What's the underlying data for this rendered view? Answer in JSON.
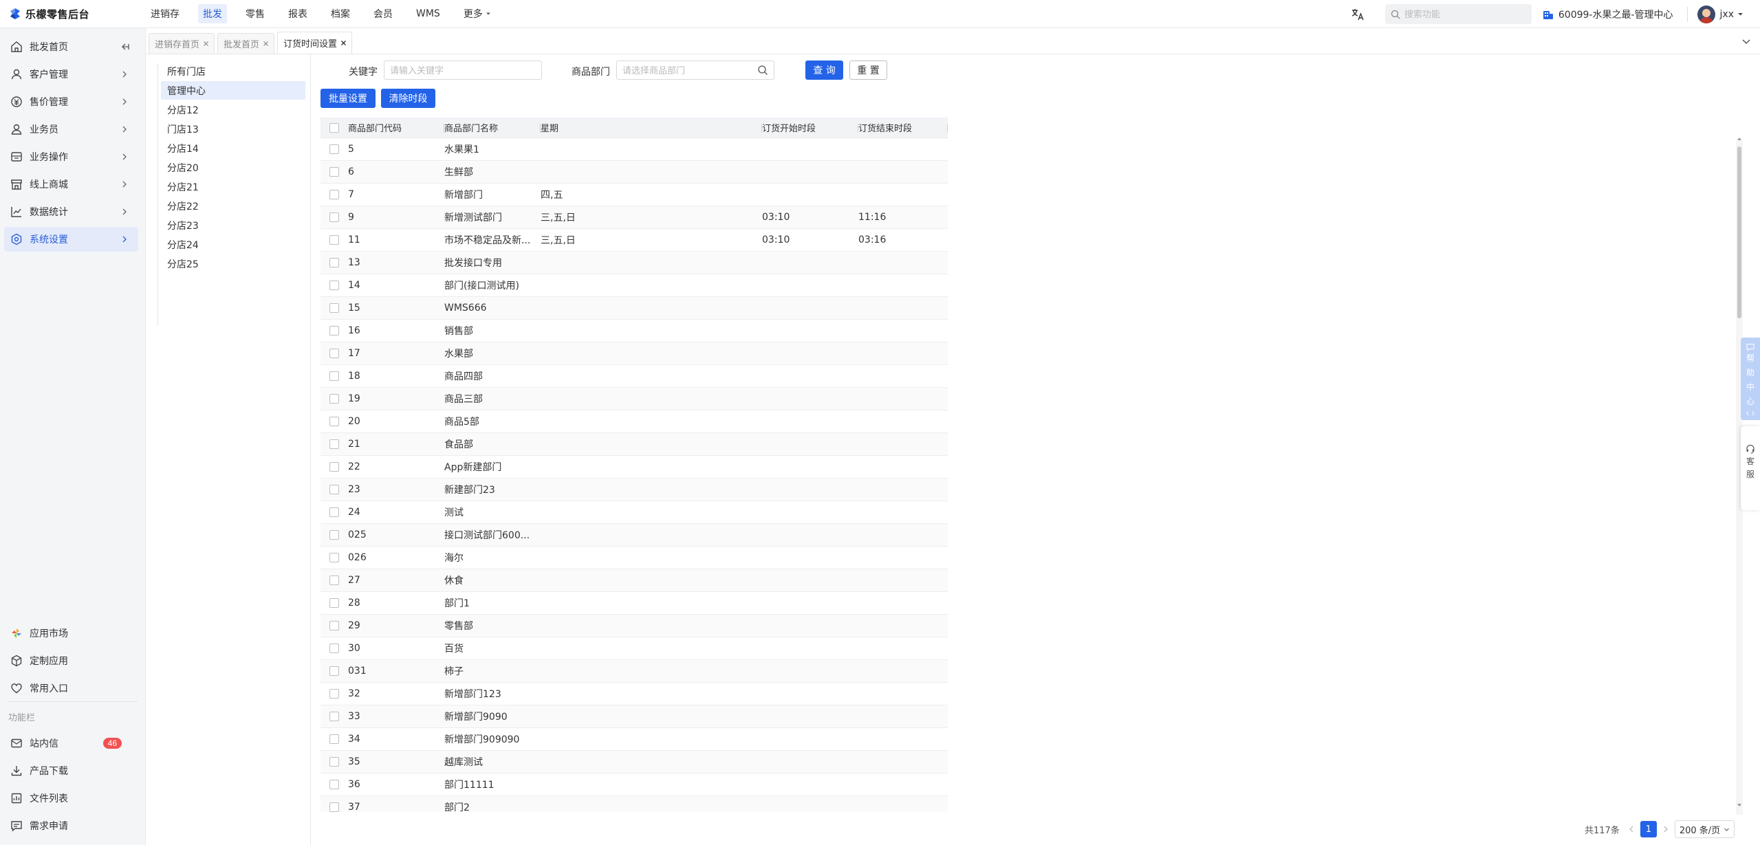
{
  "app": {
    "title": "乐檬零售后台",
    "brand_color": "#2463e8"
  },
  "topnav": {
    "items": [
      {
        "label": "进销存",
        "active": false
      },
      {
        "label": "批发",
        "active": true
      },
      {
        "label": "零售",
        "active": false
      },
      {
        "label": "报表",
        "active": false
      },
      {
        "label": "档案",
        "active": false
      },
      {
        "label": "会员",
        "active": false
      },
      {
        "label": "WMS",
        "active": false
      },
      {
        "label": "更多",
        "active": false
      }
    ],
    "search_placeholder": "搜索功能",
    "org_label": "60099-水果之最-管理中心",
    "user_name": "jxx"
  },
  "sidebar": {
    "items": [
      {
        "label": "批发首页",
        "icon": "home-icon"
      },
      {
        "label": "客户管理",
        "icon": "user-icon"
      },
      {
        "label": "售价管理",
        "icon": "price-icon"
      },
      {
        "label": "业务员",
        "icon": "salesman-icon"
      },
      {
        "label": "业务操作",
        "icon": "operation-icon"
      },
      {
        "label": "线上商城",
        "icon": "store-icon"
      },
      {
        "label": "数据统计",
        "icon": "chart-icon"
      },
      {
        "label": "系统设置",
        "icon": "settings-icon",
        "active": true
      }
    ],
    "bottom_items": [
      {
        "label": "应用市场",
        "icon": "app-market-icon"
      },
      {
        "label": "定制应用",
        "icon": "custom-app-icon"
      },
      {
        "label": "常用入口",
        "icon": "heart-icon"
      }
    ],
    "section_label": "功能栏",
    "tool_items": [
      {
        "label": "站内信",
        "icon": "message-icon",
        "badge": "46"
      },
      {
        "label": "产品下载",
        "icon": "download-icon"
      },
      {
        "label": "文件列表",
        "icon": "file-list-icon"
      },
      {
        "label": "需求申请",
        "icon": "request-icon"
      }
    ]
  },
  "tabs": [
    {
      "label": "进销存首页",
      "active": false
    },
    {
      "label": "批发首页",
      "active": false
    },
    {
      "label": "订货时间设置",
      "active": true
    }
  ],
  "store_tree": {
    "items": [
      "所有门店",
      "管理中心",
      "分店12",
      "门店13",
      "分店14",
      "分店20",
      "分店21",
      "分店22",
      "分店23",
      "分店24",
      "分店25"
    ],
    "selected": "管理中心"
  },
  "filters": {
    "keyword_label": "关键字",
    "keyword_placeholder": "请输入关键字",
    "dept_label": "商品部门",
    "dept_placeholder": "请选择商品部门",
    "query_button": "查 询",
    "reset_button": "重 置",
    "batch_button": "批量设置",
    "clear_button": "清除时段"
  },
  "table": {
    "columns": [
      "商品部门代码",
      "商品部门名称",
      "星期",
      "订货开始时段",
      "订货结束时段"
    ],
    "rows": [
      {
        "code": "5",
        "name": "水果果1",
        "week": "",
        "start": "",
        "end": ""
      },
      {
        "code": "6",
        "name": "生鲜部",
        "week": "",
        "start": "",
        "end": ""
      },
      {
        "code": "7",
        "name": "新增部门",
        "week": "四,五",
        "start": "",
        "end": ""
      },
      {
        "code": "9",
        "name": "新增测试部门",
        "week": "三,五,日",
        "start": "03:10",
        "end": "11:16"
      },
      {
        "code": "11",
        "name": "市场不稳定品及新...",
        "week": "三,五,日",
        "start": "03:10",
        "end": "03:16"
      },
      {
        "code": "13",
        "name": "批发接口专用",
        "week": "",
        "start": "",
        "end": ""
      },
      {
        "code": "14",
        "name": "部门(接口测试用)",
        "week": "",
        "start": "",
        "end": ""
      },
      {
        "code": "15",
        "name": "WMS666",
        "week": "",
        "start": "",
        "end": ""
      },
      {
        "code": "16",
        "name": "销售部",
        "week": "",
        "start": "",
        "end": ""
      },
      {
        "code": "17",
        "name": "水果部",
        "week": "",
        "start": "",
        "end": ""
      },
      {
        "code": "18",
        "name": "商品四部",
        "week": "",
        "start": "",
        "end": ""
      },
      {
        "code": "19",
        "name": "商品三部",
        "week": "",
        "start": "",
        "end": ""
      },
      {
        "code": "20",
        "name": "商品5部",
        "week": "",
        "start": "",
        "end": ""
      },
      {
        "code": "21",
        "name": "食品部",
        "week": "",
        "start": "",
        "end": ""
      },
      {
        "code": "22",
        "name": "App新建部门",
        "week": "",
        "start": "",
        "end": ""
      },
      {
        "code": "23",
        "name": "新建部门23",
        "week": "",
        "start": "",
        "end": ""
      },
      {
        "code": "24",
        "name": "测试",
        "week": "",
        "start": "",
        "end": ""
      },
      {
        "code": "025",
        "name": "接口测试部门600...",
        "week": "",
        "start": "",
        "end": ""
      },
      {
        "code": "026",
        "name": "海尔",
        "week": "",
        "start": "",
        "end": ""
      },
      {
        "code": "27",
        "name": "休食",
        "week": "",
        "start": "",
        "end": ""
      },
      {
        "code": "28",
        "name": "部门1",
        "week": "",
        "start": "",
        "end": ""
      },
      {
        "code": "29",
        "name": "零售部",
        "week": "",
        "start": "",
        "end": ""
      },
      {
        "code": "30",
        "name": "百货",
        "week": "",
        "start": "",
        "end": ""
      },
      {
        "code": "031",
        "name": "柿子",
        "week": "",
        "start": "",
        "end": ""
      },
      {
        "code": "32",
        "name": "新增部门123",
        "week": "",
        "start": "",
        "end": ""
      },
      {
        "code": "33",
        "name": "新增部门9090",
        "week": "",
        "start": "",
        "end": ""
      },
      {
        "code": "34",
        "name": "新增部门909090",
        "week": "",
        "start": "",
        "end": ""
      },
      {
        "code": "35",
        "name": "越库测试",
        "week": "",
        "start": "",
        "end": ""
      },
      {
        "code": "36",
        "name": "部门11111",
        "week": "",
        "start": "",
        "end": ""
      },
      {
        "code": "37",
        "name": "部门2",
        "week": "",
        "start": "",
        "end": ""
      }
    ]
  },
  "side_float": {
    "help_label": [
      "帮",
      "助",
      "中",
      "心"
    ],
    "service_label": [
      "客",
      "服"
    ]
  },
  "pagination": {
    "total": "共117条",
    "current_page": "1",
    "page_size": "200 条/页"
  }
}
